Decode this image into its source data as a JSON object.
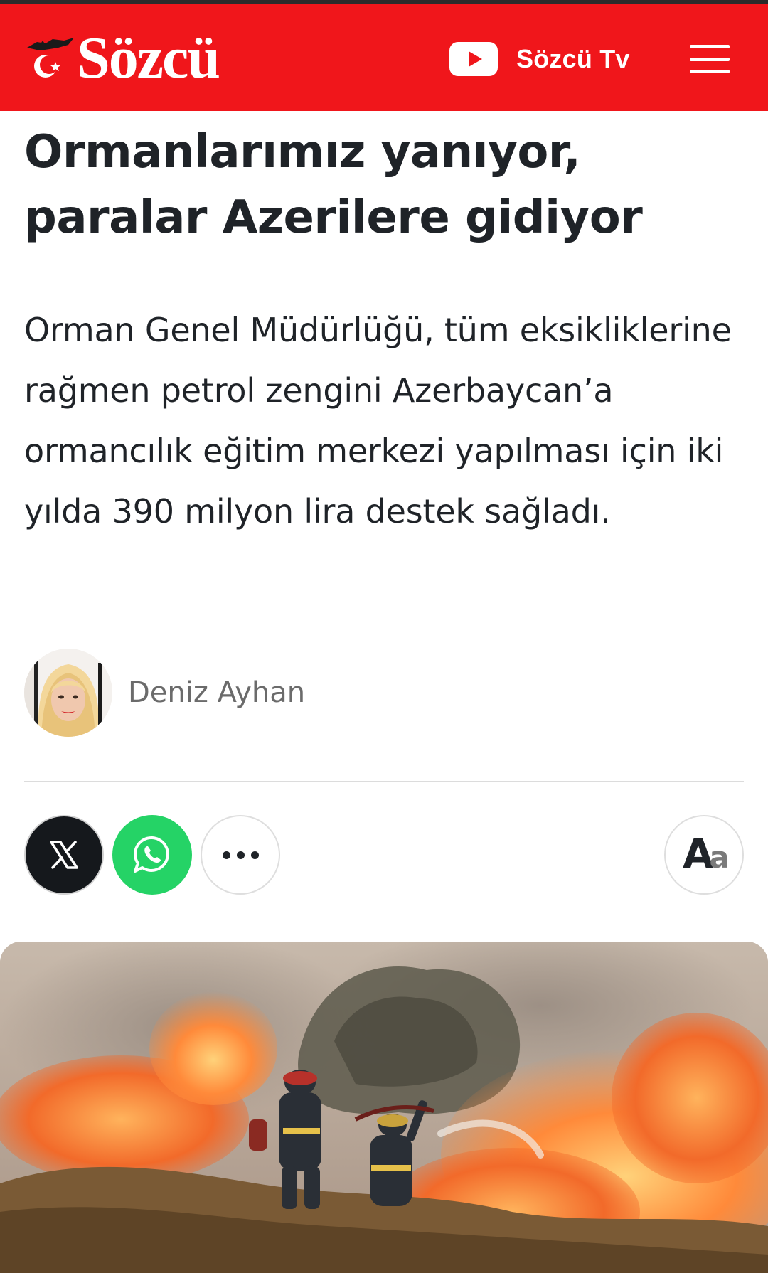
{
  "header": {
    "brand": "Sözcü",
    "tv_label": "Sözcü Tv",
    "colors": {
      "brand_red": "#f0161b",
      "text": "#1f2328",
      "muted": "#6b6b6b"
    }
  },
  "article": {
    "title": "Ormanlarımız yanıyor, paralar Azerilere gidiyor",
    "summary": "Orman Genel Müdürlüğü, tüm eksikliklerine rağmen petrol zengini Azerbaycan’a ormancılık eğitim merkezi yapılması için iki yılda 390 milyon lira destek sağladı.",
    "author": {
      "name": "Deniz Ayhan"
    }
  },
  "share": {
    "buttons": [
      {
        "icon": "x-logo-icon"
      },
      {
        "icon": "whatsapp-icon"
      },
      {
        "icon": "more-dots-icon"
      }
    ],
    "font_size_button": {
      "icon": "font-size-icon"
    }
  },
  "hero_image": {
    "subject": "firefighters-wildfire-photo"
  }
}
